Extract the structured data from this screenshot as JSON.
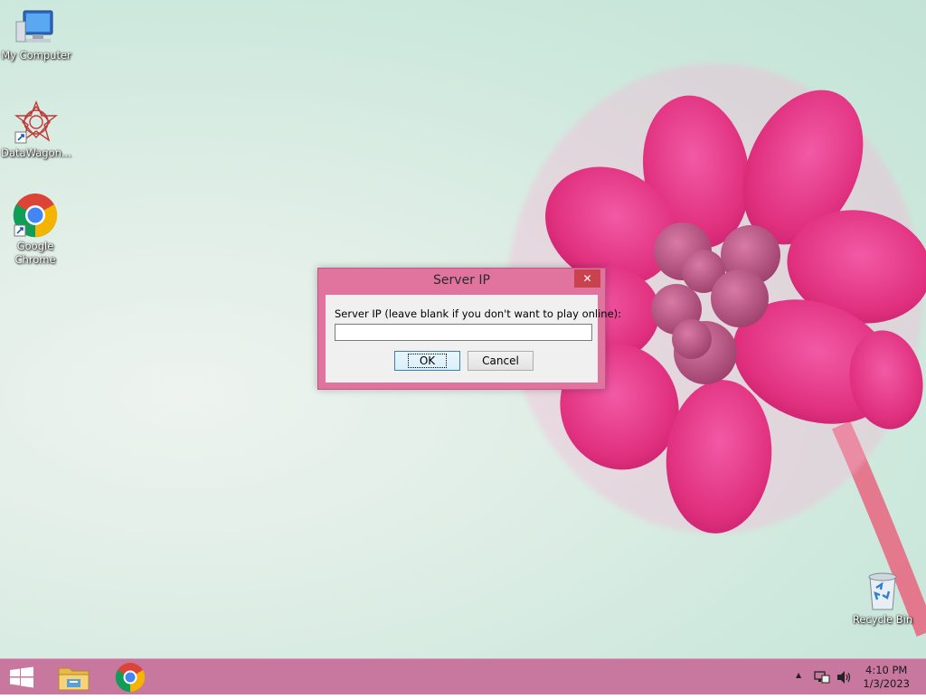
{
  "desktop": {
    "icons": [
      {
        "label": "My Computer",
        "icon": "computer-icon"
      },
      {
        "label": "DataWagon...",
        "icon": "datawagon-icon"
      },
      {
        "label": "Google Chrome",
        "icon": "chrome-icon"
      },
      {
        "label": "Recycle Bin",
        "icon": "recycle-bin-icon"
      }
    ]
  },
  "dialog": {
    "title": "Server IP",
    "close_glyph": "✕",
    "prompt": "Server IP (leave blank if you don't want to play online):",
    "input_value": "",
    "ok_label": "OK",
    "cancel_label": "Cancel"
  },
  "taskbar": {
    "buttons": [
      {
        "name": "start-button",
        "icon": "windows-icon"
      },
      {
        "name": "file-explorer-button",
        "icon": "folder-icon"
      },
      {
        "name": "chrome-taskbar-button",
        "icon": "chrome-icon"
      }
    ],
    "tray": {
      "show_hidden_glyph": "▲",
      "time": "4:10 PM",
      "date": "1/3/2023"
    }
  },
  "colors": {
    "accent": "#c8779f",
    "dialog_frame": "#e1739f",
    "close_button": "#c9434e"
  }
}
